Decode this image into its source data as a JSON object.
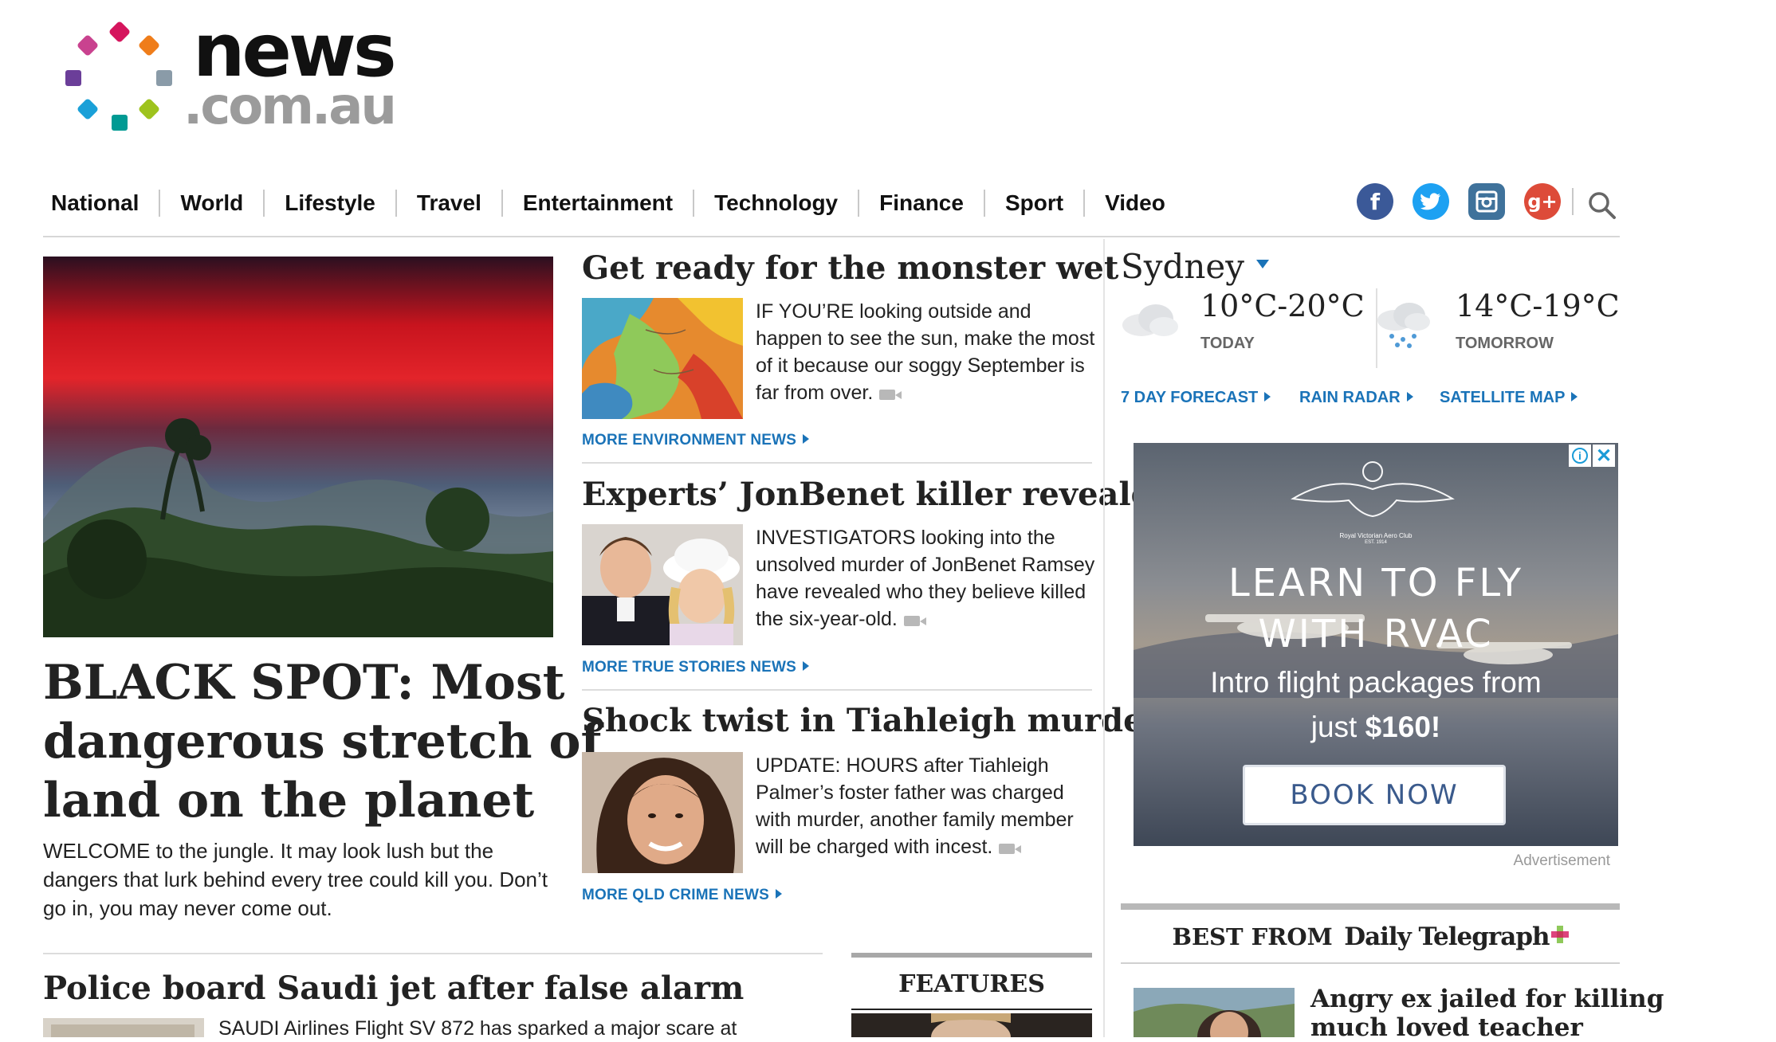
{
  "logo": {
    "word1": "news",
    "word2": ".com.au",
    "dot_colors": [
      "#d5155d",
      "#ef7d1a",
      "#8a9ba8",
      "#9ec31d",
      "#009a93",
      "#1aa0d8",
      "#6b3e99",
      "#c9428f"
    ]
  },
  "nav": {
    "items": [
      "National",
      "World",
      "Lifestyle",
      "Travel",
      "Entertainment",
      "Technology",
      "Finance",
      "Sport",
      "Video"
    ]
  },
  "social": {
    "facebook": "f",
    "twitter": "t",
    "instagram": "ig",
    "googleplus": "g+"
  },
  "lead_story": {
    "headline": "BLACK SPOT: Most dangerous stretch of land on the planet",
    "headline_lines": [
      "BLACK SPOT: Most",
      "dangerous stretch of",
      "land on the planet"
    ],
    "summary": "WELCOME to the jungle. It may look lush but the dangers that lurk behind every tree could kill you. Don’t go in, you may never come out."
  },
  "stories": [
    {
      "headline": "Get ready for the monster wet",
      "summary": "IF YOU’RE looking outside and happen to see the sun, make the most of it because our soggy September is far from over.",
      "more": "MORE ENVIRONMENT NEWS"
    },
    {
      "headline": "Experts’ JonBenet killer revealed",
      "summary": "INVESTIGATORS looking into the unsolved murder of JonBenet Ramsey have revealed who they believe killed the six-year-old.",
      "more": "MORE TRUE STORIES NEWS"
    },
    {
      "headline": "Shock twist in Tiahleigh murder",
      "summary": "UPDATE: HOURS after Tiahleigh Palmer’s foster father was charged with murder, another family member will be charged with incest.",
      "more": "MORE QLD CRIME NEWS"
    }
  ],
  "bottom_story": {
    "headline": "Police board Saudi jet after false alarm",
    "summary": "SAUDI Airlines Flight SV 872 has sparked a major scare at"
  },
  "features": {
    "title": "FEATURES"
  },
  "weather": {
    "city": "Sydney",
    "today": {
      "temp": "10°C-20°C",
      "label": "TODAY",
      "icon": "cloud-icon"
    },
    "tomorrow": {
      "temp": "14°C-19°C",
      "label": "TOMORROW",
      "icon": "rain-cloud-icon"
    },
    "links": [
      "7 DAY FORECAST",
      "RAIN RADAR",
      "SATELLITE MAP"
    ]
  },
  "ad": {
    "club": "Royal Victorian Aero Club",
    "est": "EST. 1914",
    "line1": "LEARN TO FLY",
    "line2": "WITH RVAC",
    "line3": "Intro flight packages from",
    "line4_prefix": "just ",
    "line4_price": "$160!",
    "button": "BOOK NOW",
    "label": "Advertisement"
  },
  "best_from": {
    "label": "BEST FROM",
    "brand": "Daily Telegraph",
    "story_headline_lines": [
      "Angry ex jailed for killing",
      "much loved teacher"
    ]
  },
  "colors": {
    "link": "#1a73b8",
    "facebook": "#3b5998",
    "twitter": "#1da1f2",
    "instagram": "#3f729b",
    "googleplus": "#dd4b39"
  }
}
